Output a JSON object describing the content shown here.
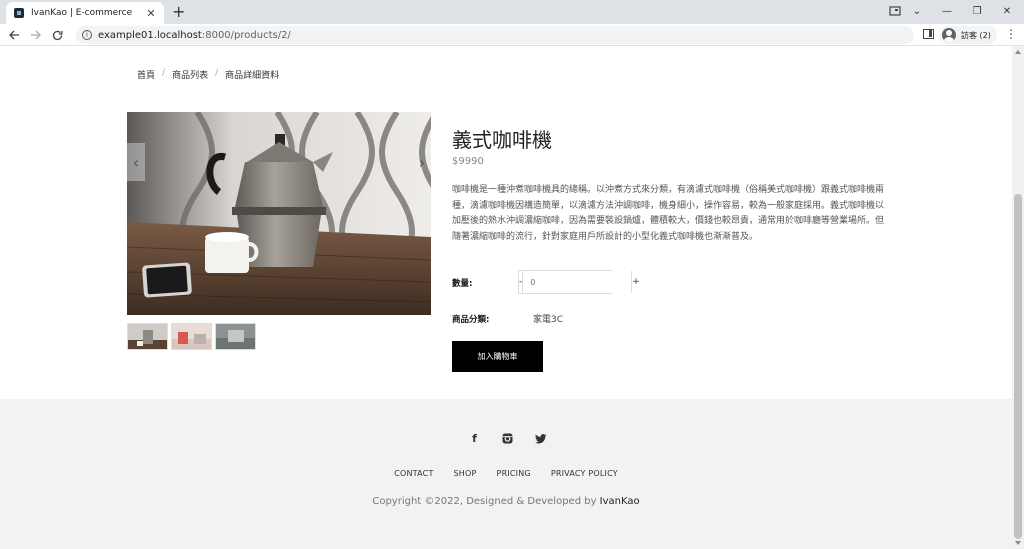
{
  "browser": {
    "tab_title": "IvanKao | E-commerce",
    "tab_close": "✕",
    "new_tab": "+",
    "url_host": "example01.localhost",
    "url_path": ":8000/products/2/",
    "profile_label": "訪客 (2)",
    "window_controls": [
      "⌄",
      "—",
      "❐",
      "✕"
    ]
  },
  "breadcrumb": {
    "items": [
      "首頁",
      "商品列表",
      "商品詳細資料"
    ],
    "separator": "/"
  },
  "gallery": {
    "prev_icon": "‹",
    "next_icon": "›",
    "thumbnail_count": 3,
    "active_thumbnail": 1
  },
  "product": {
    "title": "義式咖啡機",
    "price": "$9990",
    "description": "咖啡機是一種沖煮咖啡機具的總稱。以沖煮方式來分類，有滴濾式咖啡機（俗稱美式咖啡機）跟義式咖啡機兩種，滴濾咖啡機因構造簡單，以滴濾方法沖調咖啡，機身細小，操作容易，較為一般家庭採用。義式咖啡機以加壓後的熱水沖調濃縮咖啡，因為需要裝設鍋爐，體積較大，價錢也較昂貴，通常用於咖啡廳等營業場所。但隨著濃縮咖啡的流行，針對家庭用戶所設計的小型化義式咖啡機也漸漸普及。",
    "quantity_label": "數量:",
    "quantity_minus": "-",
    "quantity_plus": "+",
    "quantity_placeholder": "0",
    "category_label": "商品分類:",
    "category_value": "家電3C",
    "add_to_cart": "加入購物車"
  },
  "footer": {
    "socials": [
      "facebook-icon",
      "instagram-icon",
      "twitter-icon"
    ],
    "facebook_glyph": "f",
    "twitter_glyph": "🐦",
    "nav": [
      "CONTACT",
      "SHOP",
      "PRICING",
      "PRIVACY POLICY"
    ],
    "copyright_prefix": "Copyright ©2022, Designed & Developed by ",
    "copyright_author": "IvanKao"
  }
}
